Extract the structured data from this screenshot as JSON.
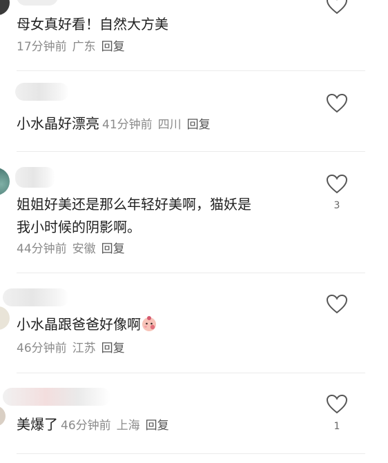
{
  "comments": [
    {
      "text": "母女真好看！自然大方美",
      "time": "17分钟前",
      "location": "广东",
      "reply": "回复",
      "likes": ""
    },
    {
      "text": "小水晶好漂亮",
      "time": "41分钟前",
      "location": "四川",
      "reply": "回复",
      "likes": ""
    },
    {
      "text_line1": "姐姐好美还是那么年轻好美啊，猫妖是",
      "text_line2": "我小时候的阴影啊。",
      "time": "44分钟前",
      "location": "安徽",
      "reply": "回复",
      "likes": "3"
    },
    {
      "text": "小水晶跟爸爸好像啊",
      "emoji": "baby-face-emoji",
      "time": "46分钟前",
      "location": "江苏",
      "reply": "回复",
      "likes": ""
    },
    {
      "text": "美爆了",
      "time": "46分钟前",
      "location": "上海",
      "reply": "回复",
      "likes": "1"
    }
  ],
  "icons": {
    "like": "heart-outline-icon"
  },
  "colors": {
    "text": "#1f1f1f",
    "meta": "#8a8a8a",
    "reply": "#555555",
    "divider": "#ebebeb"
  }
}
